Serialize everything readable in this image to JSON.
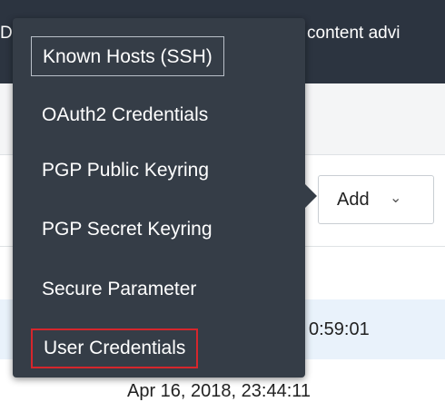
{
  "topbar": {
    "text": "content advi",
    "left_fragment": "D"
  },
  "toolbar": {
    "add_label": "Add"
  },
  "rows": {
    "faint": "",
    "time_selected": "0:59:01",
    "time_next": "Apr 16, 2018, 23:44:11"
  },
  "menu": {
    "items": [
      {
        "label": "Known Hosts (SSH)"
      },
      {
        "label": "OAuth2 Credentials"
      },
      {
        "label": "PGP Public Keyring"
      },
      {
        "label": "PGP Secret Keyring"
      },
      {
        "label": "Secure Parameter"
      },
      {
        "label": "User Credentials"
      }
    ]
  },
  "colors": {
    "topbar": "#2c3440",
    "menu_bg": "#353d47",
    "highlight_border": "#d6262c",
    "selected_row": "#e9f2fb"
  }
}
